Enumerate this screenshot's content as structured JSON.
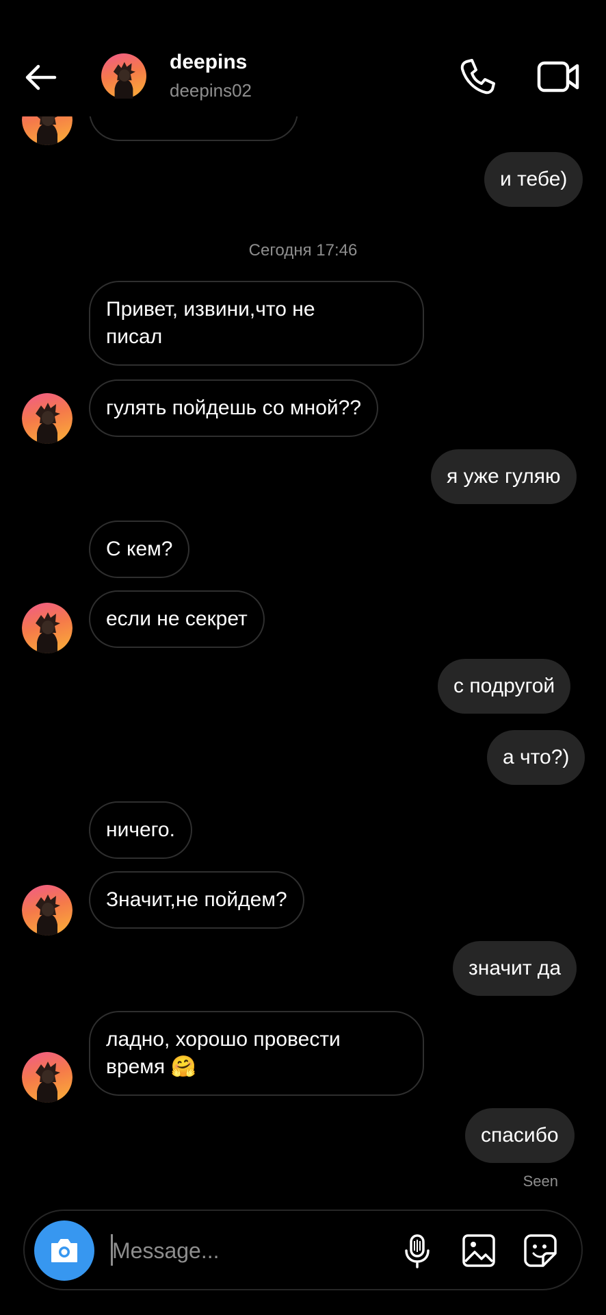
{
  "header": {
    "display_name": "deepins",
    "username": "deepins02"
  },
  "thread": {
    "timestamp": "Сегодня 17:46",
    "seen_label": "Seen",
    "messages": [
      {
        "from": "me",
        "text": "и тебе)"
      },
      {
        "from": "them",
        "text": "Привет, извини,что не\nписал"
      },
      {
        "from": "them",
        "text": "гулять пойдешь со мной??"
      },
      {
        "from": "me",
        "text": "я уже гуляю"
      },
      {
        "from": "them",
        "text": "С кем?"
      },
      {
        "from": "them",
        "text": "если не секрет"
      },
      {
        "from": "me",
        "text": "с подругой"
      },
      {
        "from": "me",
        "text": "а что?)"
      },
      {
        "from": "them",
        "text": "ничего."
      },
      {
        "from": "them",
        "text": "Значит,не пойдем?"
      },
      {
        "from": "me",
        "text": "значит да"
      },
      {
        "from": "them",
        "text": "ладно, хорошо провести\nвремя 🤗"
      },
      {
        "from": "me",
        "text": "спасибо"
      }
    ]
  },
  "composer": {
    "placeholder": "Message...",
    "value": ""
  },
  "colors": {
    "background": "#000000",
    "outgoing_bubble": "#262626",
    "incoming_border": "#2f2f2f",
    "secondary_text": "#8e8e8e",
    "camera_button": "#3797f0"
  },
  "icons": {
    "back": "arrow-left-icon",
    "call": "phone-icon",
    "video": "video-camera-icon",
    "camera": "camera-icon",
    "mic": "microphone-icon",
    "gallery": "image-icon",
    "sticker": "sticker-icon"
  }
}
